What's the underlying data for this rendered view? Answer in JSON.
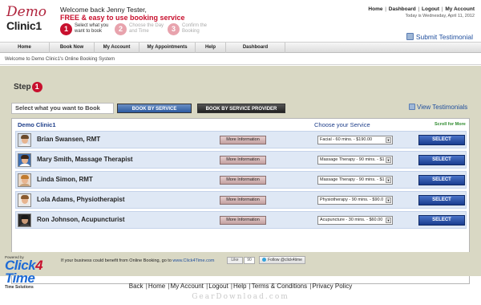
{
  "logo": {
    "line1": "Demo",
    "line2": "Clinic1"
  },
  "header": {
    "welcome": "Welcome back Jenny Tester,",
    "tagline": "FREE & easy to use booking service",
    "steps": [
      {
        "num": "1",
        "label": "Select what you want to book"
      },
      {
        "num": "2",
        "label": "Choose the Day and Time"
      },
      {
        "num": "3",
        "label": "Confirm the Booking"
      }
    ],
    "toplinks": [
      "Home",
      "Dashboard",
      "Logout",
      "My Account"
    ],
    "today": "Today is Wednesday, April 11, 2012",
    "submit_testimonial": "Submit Testimonial"
  },
  "nav": [
    "Home",
    "Book Now",
    "My Account",
    "My Appointments",
    "Help",
    "Dashboard"
  ],
  "breadcrumb": "Welcome to Demo Clinic1's Online Booking System",
  "main": {
    "step_label": "Step",
    "step_num": "1",
    "select_label": "Select what you want to Book",
    "tab_service": "BOOK BY SERVICE",
    "tab_provider": "BOOK BY SERVICE PROVIDER",
    "view_testimonials": "View Testimonials",
    "panel_title": "Demo Clinic1",
    "choose_service": "Choose your Service",
    "scroll_more": "Scroll for More",
    "more_info": "More Information",
    "select_btn": "SELECT",
    "providers": [
      {
        "name": "Brian Swansen, RMT",
        "service": "Facial - 60 mins. - $190.00"
      },
      {
        "name": "Mary Smith, Massage Therapist",
        "service": "Massage Therapy - 90 mins. - $1"
      },
      {
        "name": "Linda Simon, RMT",
        "service": "Massage Therapy - 90 mins. - $1"
      },
      {
        "name": "Lola Adams, Physiotherapist",
        "service": "Physiotherapy - 90 mins. - $90.0"
      },
      {
        "name": "Ron Johnson, Acupuncturist",
        "service": "Acupuncture - 30 mins. - $60.00"
      }
    ]
  },
  "footer": {
    "powered": "Powered by",
    "brand_a": "Click",
    "brand_b": "4",
    "brand_c": "Time",
    "solutions": "Time Solutions",
    "promo_text": "If your business could benefit from Online Booking, go to",
    "promo_link": "www.Click4Time.com",
    "like": "Like",
    "like_count": "90",
    "follow": "Follow @click4time",
    "links": [
      "Back",
      "Home",
      "My Account",
      "Logout",
      "Help",
      "Terms & Conditions",
      "Privacy Policy"
    ],
    "watermark": "GearDownload.com"
  }
}
